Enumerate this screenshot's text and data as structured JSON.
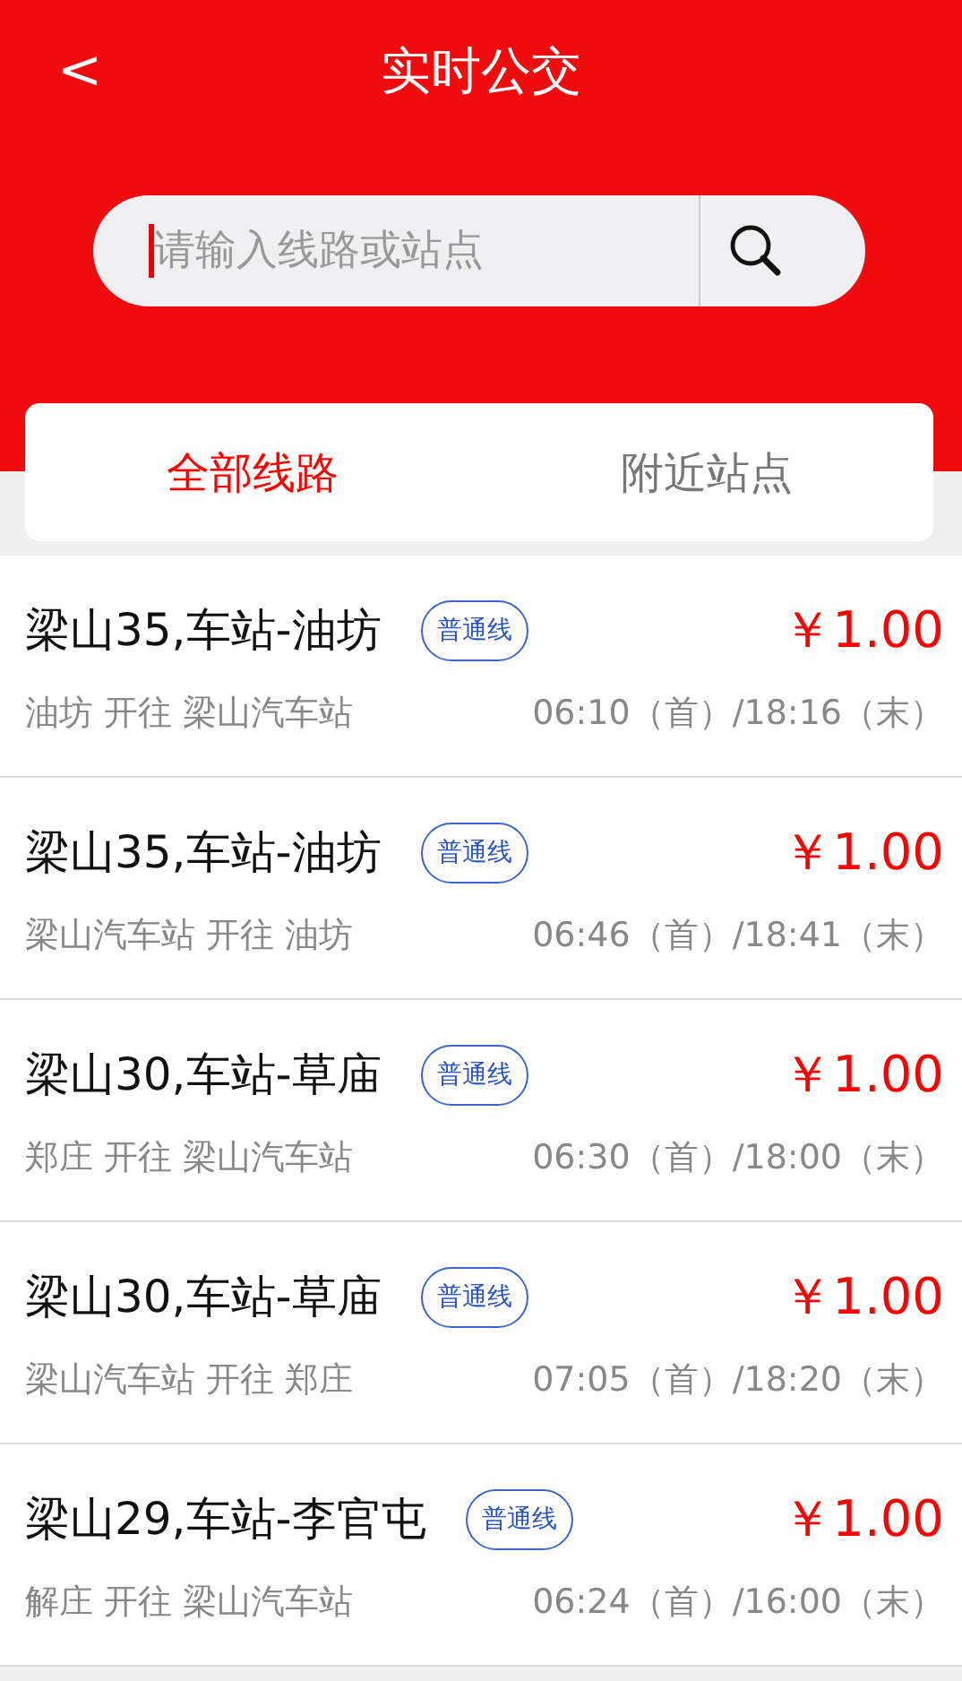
{
  "header": {
    "title": "实时公交",
    "back": "<"
  },
  "search": {
    "placeholder": "请输入线路或站点"
  },
  "tabs": [
    {
      "label": "全部线路",
      "selected": true
    },
    {
      "label": "附近站点",
      "selected": false
    }
  ],
  "routes": [
    {
      "name": "梁山35,车站-油坊",
      "badge": "普通线",
      "price": "￥1.00",
      "direction": "油坊 开往 梁山汽车站",
      "times": "06:10（首）/18:16（末）"
    },
    {
      "name": "梁山35,车站-油坊",
      "badge": "普通线",
      "price": "￥1.00",
      "direction": "梁山汽车站 开往 油坊",
      "times": "06:46（首）/18:41（末）"
    },
    {
      "name": "梁山30,车站-草庙",
      "badge": "普通线",
      "price": "￥1.00",
      "direction": "郑庄 开往 梁山汽车站",
      "times": "06:30（首）/18:00（末）"
    },
    {
      "name": "梁山30,车站-草庙",
      "badge": "普通线",
      "price": "￥1.00",
      "direction": "梁山汽车站 开往 郑庄",
      "times": "07:05（首）/18:20（末）"
    },
    {
      "name": "梁山29,车站-李官屯",
      "badge": "普通线",
      "price": "￥1.00",
      "direction": "解庄 开往 梁山汽车站",
      "times": "06:24（首）/16:00（末）"
    }
  ]
}
